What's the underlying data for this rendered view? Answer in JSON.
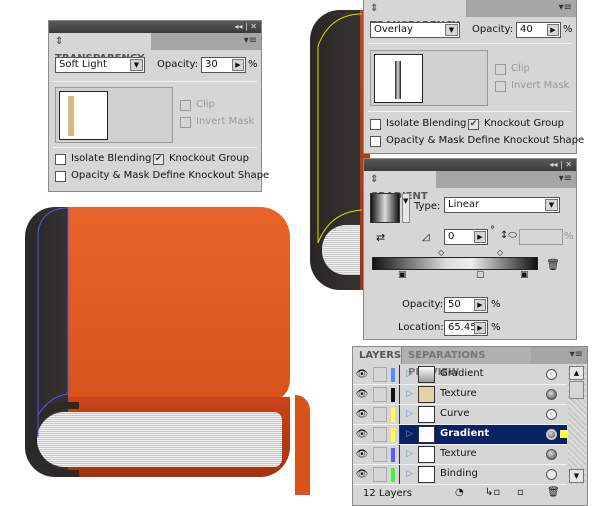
{
  "transparency_panel_1": {
    "tab": "TRANSPARENCY",
    "blend_mode": "Soft Light",
    "opacity_label": "Opacity:",
    "opacity_value": "30",
    "percent": "%",
    "clip": "Clip",
    "invert_mask": "Invert Mask",
    "isolate_blending": "Isolate Blending",
    "knockout_group": "Knockout Group",
    "opacity_mask_knockout": "Opacity & Mask Define Knockout Shape"
  },
  "transparency_panel_2": {
    "tab": "TRANSPARENCY",
    "blend_mode": "Overlay",
    "opacity_label": "Opacity:",
    "opacity_value": "40",
    "percent": "%",
    "clip": "Clip",
    "invert_mask": "Invert Mask",
    "isolate_blending": "Isolate Blending",
    "knockout_group": "Knockout Group",
    "opacity_mask_knockout": "Opacity & Mask Define Knockout Shape"
  },
  "gradient_panel": {
    "tab": "GRADIENT",
    "type_label": "Type:",
    "type_value": "Linear",
    "angle_value": "0",
    "degree": "°",
    "aspect_percent": "%",
    "opacity_label": "Opacity:",
    "opacity_value": "50",
    "location_label": "Location:",
    "location_value": "65.45",
    "percent": "%"
  },
  "layers_panel": {
    "tabs": [
      "LAYERS",
      "SEPARATIONS PREVIEW"
    ],
    "layers": [
      {
        "name": "Gradient",
        "color": "#5b8cff",
        "target": "empty",
        "selected": false
      },
      {
        "name": "Texture",
        "color": "#111111",
        "target": "filled",
        "selected": false
      },
      {
        "name": "Curve",
        "color": "#ffff44",
        "target": "empty",
        "selected": false
      },
      {
        "name": "Gradient",
        "color": "#ffff44",
        "target": "filled",
        "selected": true
      },
      {
        "name": "Texture",
        "color": "#5b5bff",
        "target": "filled",
        "selected": false
      },
      {
        "name": "Binding",
        "color": "#44ee44",
        "target": "empty",
        "selected": false
      }
    ],
    "count": "12 Layers"
  },
  "window_controls": "◂◂ | ✕"
}
